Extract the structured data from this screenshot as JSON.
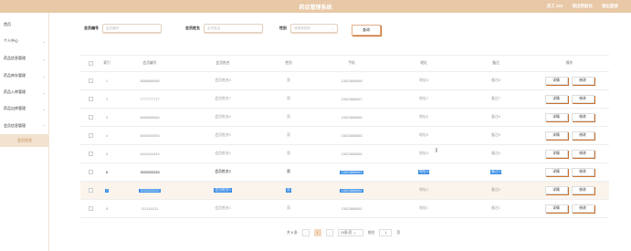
{
  "header": {
    "title": "药店管理系统",
    "user": "员工 222",
    "back_label": "退出到前台",
    "logout_label": "退出登录"
  },
  "sidebar": {
    "items": [
      {
        "label": "首页",
        "chevron": false
      },
      {
        "label": "个人中心",
        "chevron": true
      },
      {
        "label": "药品信息管理",
        "chevron": true
      },
      {
        "label": "药品库存管理",
        "chevron": true
      },
      {
        "label": "药品入库管理",
        "chevron": true
      },
      {
        "label": "药品出库管理",
        "chevron": true
      },
      {
        "label": "会员信息管理",
        "chevron": true
      }
    ],
    "active_sub": "会员信息"
  },
  "search": {
    "member_no_label": "会员编号",
    "member_no_placeholder": "会员编号",
    "member_name_label": "会员姓名",
    "member_name_placeholder": "会员姓名",
    "gender_label": "性别",
    "gender_placeholder": "请选择性别",
    "button": "查询"
  },
  "table": {
    "headers": [
      "索引",
      "会员编号",
      "会员姓名",
      "性别",
      "手机",
      "地址",
      "备注",
      "操作"
    ],
    "detail_label": "详情",
    "edit_label": "修改",
    "rows": [
      {
        "index": "1",
        "no": "8888888888",
        "name": "会员姓名8",
        "gender": "男",
        "phone": "13823888888",
        "addr": "地址8",
        "note": "备注8"
      },
      {
        "index": "2",
        "no": "7777777777",
        "name": "会员姓名7",
        "gender": "男",
        "phone": "13823888887",
        "addr": "地址7",
        "note": "备注7"
      },
      {
        "index": "3",
        "no": "6666666666",
        "name": "会员姓名6",
        "gender": "男",
        "phone": "13823888886",
        "addr": "地址6",
        "note": "备注6"
      },
      {
        "index": "4",
        "no": "5555555555",
        "name": "会员姓名5",
        "gender": "男",
        "phone": "13823888885",
        "addr": "地址5",
        "note": "备注5"
      },
      {
        "index": "5",
        "no": "4444444444",
        "name": "会员姓名4",
        "gender": "男",
        "phone": "13823888884",
        "addr": "地址4",
        "note": "备注4"
      },
      {
        "index": "6",
        "no": "3333333333",
        "name": "会员姓名3",
        "gender": "男",
        "phone": "13823888883",
        "addr": "地址3",
        "note": "备注3"
      },
      {
        "index": "7",
        "no": "2222222222",
        "name": "会员姓名2",
        "gender": "男",
        "phone": "13823888882",
        "addr": "地址2",
        "note": "备注2"
      },
      {
        "index": "8",
        "no": "1111111111",
        "name": "会员姓名1",
        "gender": "男",
        "phone": "13823888881",
        "addr": "地址1",
        "note": "备注1"
      }
    ]
  },
  "pagination": {
    "total": "共 8 条",
    "page": "1",
    "per_page": "10条/页",
    "goto": "前往",
    "goto_value": "1",
    "page_unit": "页"
  }
}
